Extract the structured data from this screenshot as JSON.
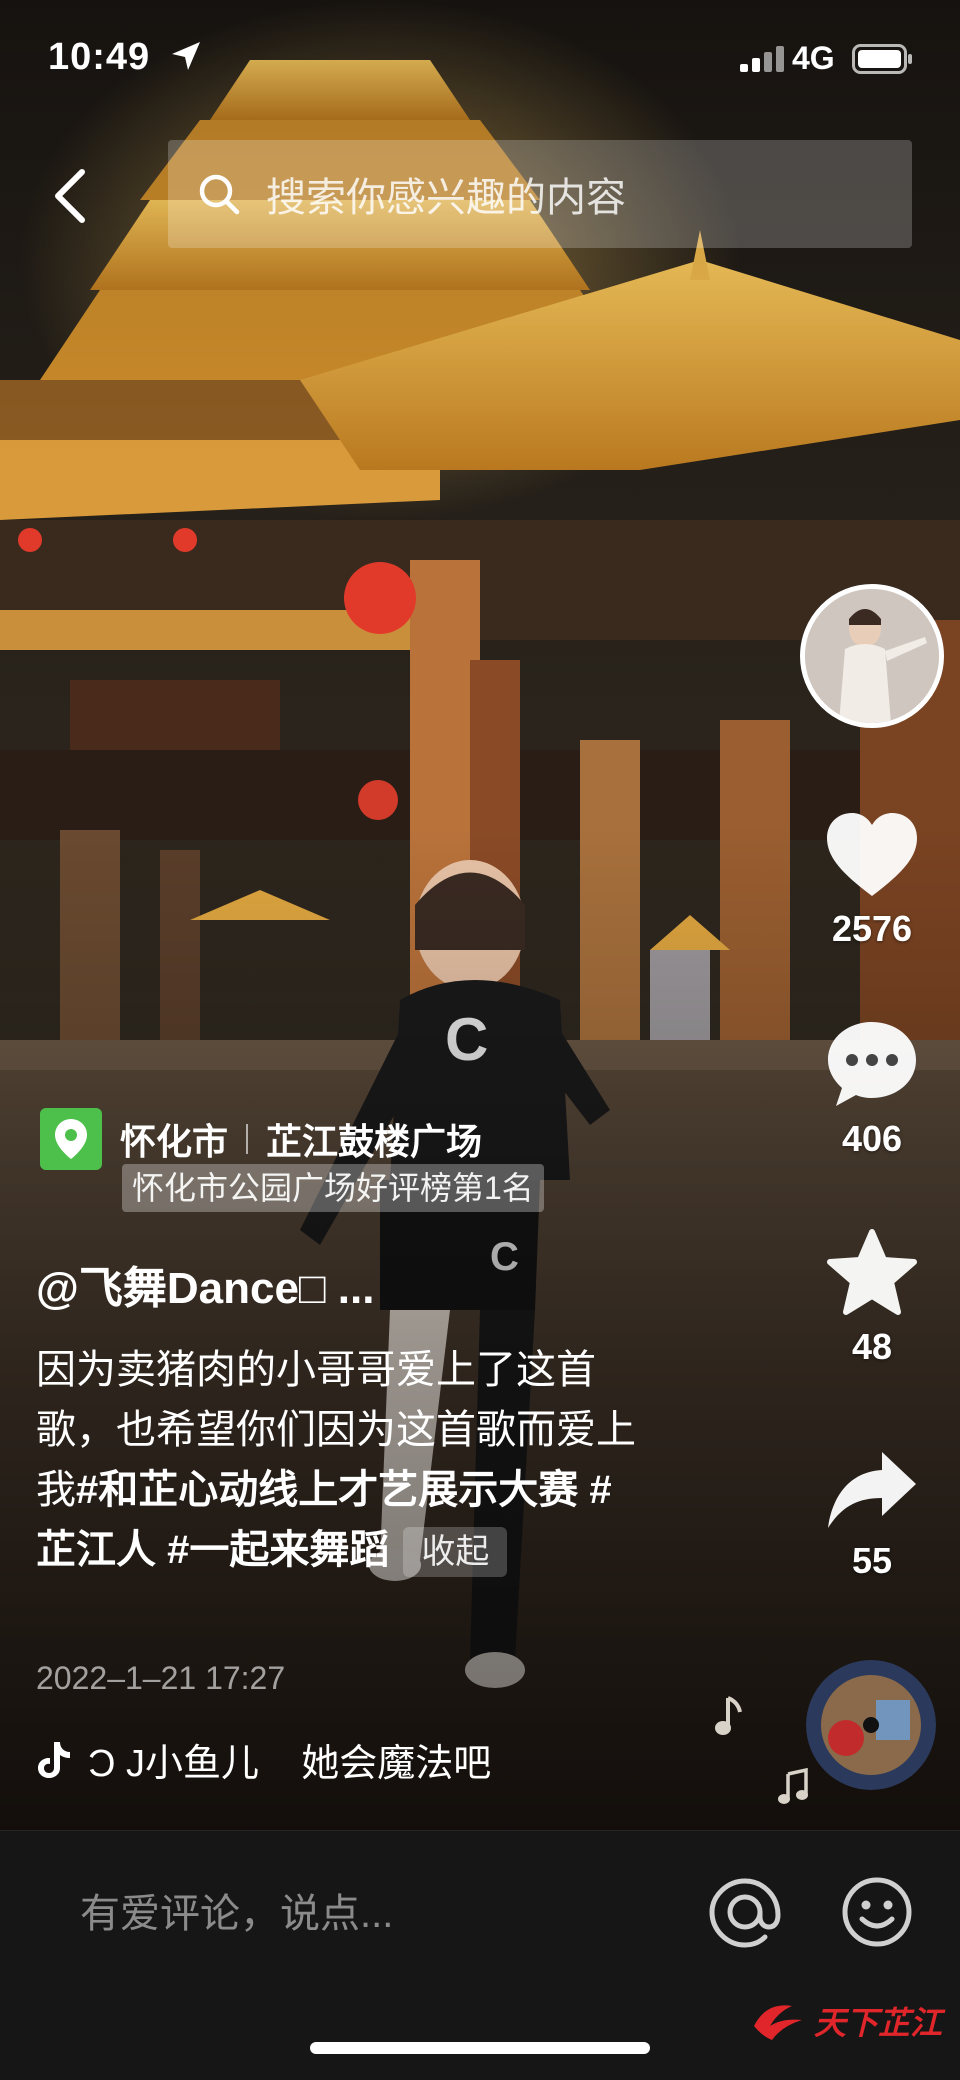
{
  "status_bar": {
    "time": "10:49",
    "network": "4G"
  },
  "search": {
    "placeholder": "搜索你感兴趣的内容"
  },
  "actions": {
    "likes": "2576",
    "comments": "406",
    "favorites": "48",
    "shares": "55"
  },
  "poi": {
    "city": "怀化市",
    "place": "芷江鼓楼广场",
    "rank": "怀化市公园广场好评榜第1名"
  },
  "author": {
    "name": "@飞舞Dance□ ..."
  },
  "caption": {
    "text": "因为卖猪肉的小哥哥爱上了这首歌，也希望你们因为这首歌而爱上我",
    "hashtags": [
      "#和芷心动线上才艺展示大赛",
      "#芷江人",
      "#一起来舞蹈"
    ],
    "collapse_label": "收起"
  },
  "post": {
    "date": "2022–1–21 17:27"
  },
  "music": {
    "text": "Ͻ J小鱼儿    她会魔法吧"
  },
  "comment_bar": {
    "placeholder": "有爱评论，说点..."
  },
  "watermark": {
    "text": "天下芷江"
  },
  "colors": {
    "accent_like": "#ffffff",
    "poi_green": "#4cc04b",
    "watermark_red": "#e0262a",
    "comment_bar_bg": "#161616"
  }
}
